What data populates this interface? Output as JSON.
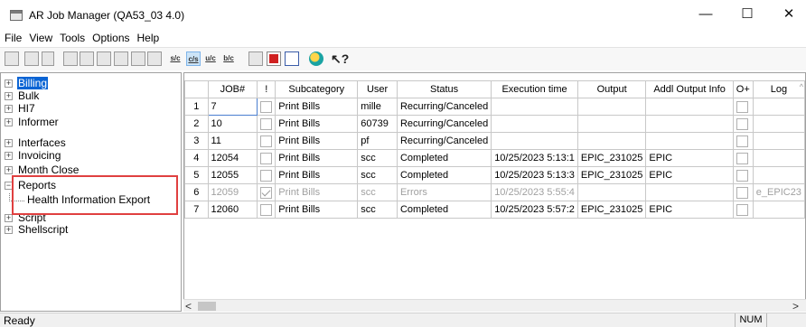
{
  "window": {
    "title": "AR Job Manager (QA53_03 4.0)",
    "minimize": "—",
    "maximize": "☐",
    "close": "✕"
  },
  "menu": [
    "File",
    "View",
    "Tools",
    "Options",
    "Help"
  ],
  "toolbar": {
    "sc_label": "s/c",
    "cs_label": "c/s",
    "uc_label": "u/c",
    "bc_label": "b/c",
    "help_glyph": "↖?"
  },
  "tree": {
    "items": [
      {
        "label": "Billing"
      },
      {
        "label": "Bulk"
      },
      {
        "label": "HI7"
      },
      {
        "label": "Informer"
      },
      {
        "label": "Interfaces"
      },
      {
        "label": "Invoicing"
      },
      {
        "label": "Month Close"
      },
      {
        "label": "Reports"
      },
      {
        "label": "Health Information Export"
      },
      {
        "label": "Script"
      },
      {
        "label": "Shellscript"
      }
    ],
    "expand_glyph": "+",
    "collapse_glyph": "−"
  },
  "grid": {
    "columns": [
      "JOB#",
      "!",
      "Subcategory",
      "User",
      "Status",
      "Execution time",
      "Output",
      "Addl Output Info",
      "O+",
      "Log"
    ],
    "rows": [
      {
        "n": "1",
        "job": "7",
        "checked": false,
        "subcategory": "Print Bills",
        "user": "mille",
        "status": "Recurring/Canceled",
        "exec": "",
        "output": "",
        "addl": "",
        "log": ""
      },
      {
        "n": "2",
        "job": "10",
        "checked": false,
        "subcategory": "Print Bills",
        "user": "60739",
        "status": "Recurring/Canceled",
        "exec": "",
        "output": "",
        "addl": "",
        "log": ""
      },
      {
        "n": "3",
        "job": "11",
        "checked": false,
        "subcategory": "Print Bills",
        "user": "pf",
        "status": "Recurring/Canceled",
        "exec": "",
        "output": "",
        "addl": "",
        "log": ""
      },
      {
        "n": "4",
        "job": "12054",
        "checked": false,
        "subcategory": "Print Bills",
        "user": "scc",
        "status": "Completed",
        "exec": "10/25/2023 5:13:1",
        "output": "EPIC_231025",
        "addl": "EPIC",
        "log": ""
      },
      {
        "n": "5",
        "job": "12055",
        "checked": false,
        "subcategory": "Print Bills",
        "user": "scc",
        "status": "Completed",
        "exec": "10/25/2023 5:13:3",
        "output": "EPIC_231025",
        "addl": "EPIC",
        "log": ""
      },
      {
        "n": "6",
        "job": "12059",
        "checked": true,
        "subcategory": "Print Bills",
        "user": "scc",
        "status": "Errors",
        "exec": "10/25/2023 5:55:4",
        "output": "",
        "addl": "",
        "log": "e_EPIC23"
      },
      {
        "n": "7",
        "job": "12060",
        "checked": false,
        "subcategory": "Print Bills",
        "user": "scc",
        "status": "Completed",
        "exec": "10/25/2023 5:57:2",
        "output": "EPIC_231025",
        "addl": "EPIC",
        "log": ""
      }
    ]
  },
  "scroll": {
    "left": "<",
    "right": ">",
    "up": "^"
  },
  "status": {
    "text": "Ready",
    "num": "NUM"
  }
}
